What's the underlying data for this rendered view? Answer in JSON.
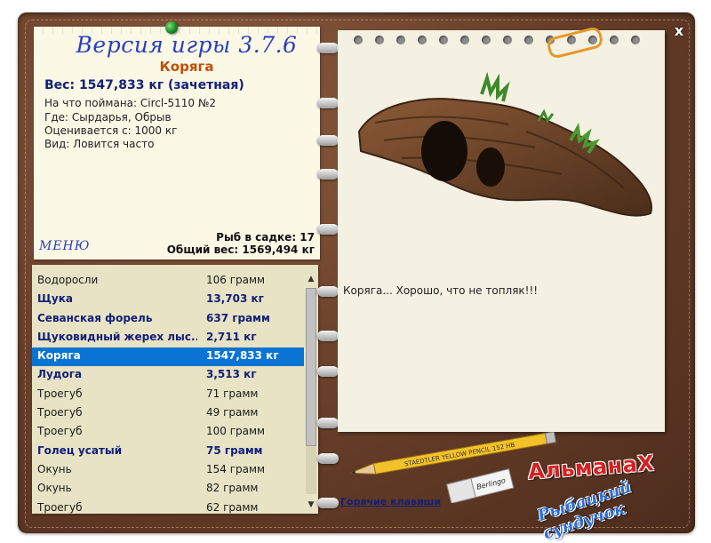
{
  "window": {
    "close_label": "x"
  },
  "left_page": {
    "version_label": "Версия игры 3.7.6",
    "fish_name": "Коряга",
    "weight_line": "Вес: 1547,833 кг (зачетная)",
    "caught_with": "На что поймана: Circl-5110 №2",
    "location": "Где: Сырдарья, Обрыв",
    "rated_from": "Оценивается с: 1000 кг",
    "kind": "Вид: Ловится часто",
    "menu_label": "МЕНЮ",
    "fish_in_keepnet": "Рыб в садке: 17",
    "total_weight": "Общий вес: 1569,494 кг"
  },
  "fish_list": [
    {
      "name": "Водоросли",
      "weight": "106 грамм",
      "bold": false,
      "selected": false
    },
    {
      "name": "Щука",
      "weight": "13,703 кг",
      "bold": true,
      "selected": false
    },
    {
      "name": "Севанская форель",
      "weight": "637 грамм",
      "bold": true,
      "selected": false
    },
    {
      "name": "Щуковидный жерех лыс...",
      "weight": "2,711 кг",
      "bold": true,
      "selected": false
    },
    {
      "name": "Коряга",
      "weight": "1547,833 кг",
      "bold": true,
      "selected": true
    },
    {
      "name": "Лудога",
      "weight": "3,513 кг",
      "bold": true,
      "selected": false
    },
    {
      "name": "Троегуб",
      "weight": "71 грамм",
      "bold": false,
      "selected": false
    },
    {
      "name": "Троегуб",
      "weight": "49 грамм",
      "bold": false,
      "selected": false
    },
    {
      "name": "Троегуб",
      "weight": "100 грамм",
      "bold": false,
      "selected": false
    },
    {
      "name": "Голец усатый",
      "weight": "75 грамм",
      "bold": true,
      "selected": false
    },
    {
      "name": "Окунь",
      "weight": "154 грамм",
      "bold": false,
      "selected": false
    },
    {
      "name": "Окунь",
      "weight": "82 грамм",
      "bold": false,
      "selected": false
    },
    {
      "name": "Троегуб",
      "weight": "62 грамм",
      "bold": false,
      "selected": false
    }
  ],
  "right_page": {
    "description": "Коряга... Хорошо, что не топляк!!!",
    "hotkeys_label": "Горячие клавиши"
  },
  "pencil_text": "STAEDTLER YELLOW PENCIL 152 HB",
  "eraser_text": "Berlingo",
  "logo": {
    "main": "АльманаХ",
    "sub": "Рыбацкий сундучок"
  },
  "colors": {
    "accent_blue": "#2a3fc0",
    "fish_name": "#c24e08",
    "selection": "#0a74d4",
    "leather": "#6b412b"
  },
  "icons": {
    "pin": "green-pin-icon",
    "close": "close-icon",
    "scroll_up": "arrow-up-icon",
    "scroll_down": "arrow-down-icon"
  }
}
